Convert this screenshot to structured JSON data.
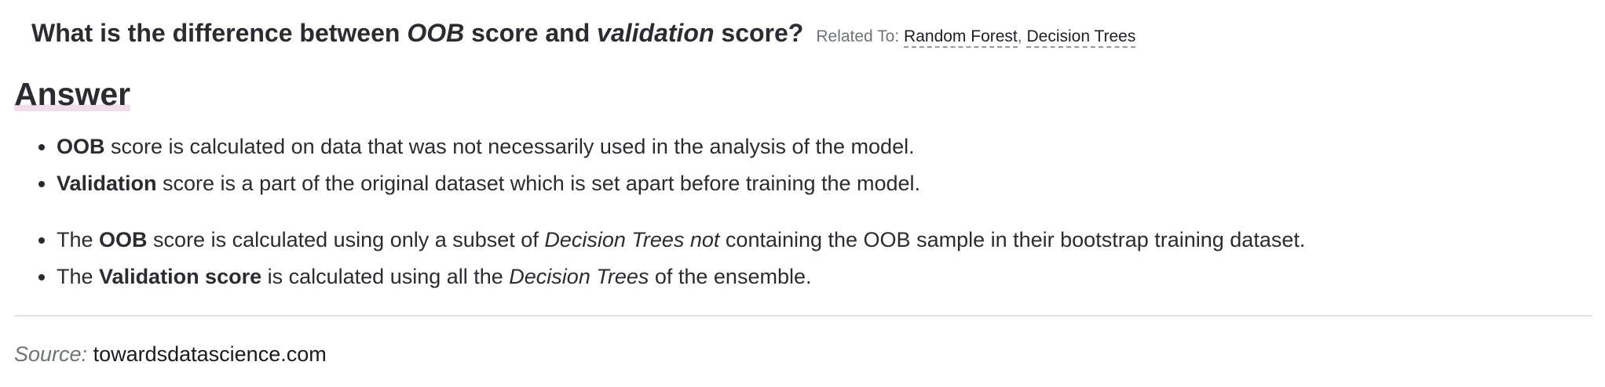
{
  "question": {
    "parts": [
      "What is the difference between ",
      "OOB",
      " score and ",
      "validation",
      " score?"
    ],
    "related_label": "Related To:",
    "related_links": [
      "Random Forest",
      "Decision Trees"
    ],
    "related_separator": ","
  },
  "answer": {
    "heading": "Answer",
    "group1": [
      {
        "bold": "OOB",
        "text": " score is calculated on data that was not necessarily used in the analysis of the model."
      },
      {
        "bold": "Validation",
        "text": " score is a part of the original dataset which is set apart before training the model."
      }
    ],
    "group2": [
      {
        "pre": "The ",
        "bold": "OOB",
        "mid": " score is calculated using only a subset of ",
        "italic": "Decision Trees not",
        "post": " containing the OOB sample in their bootstrap training dataset."
      },
      {
        "pre": "The ",
        "bold": "Validation score",
        "mid": " is calculated using all the ",
        "italic": "Decision Trees",
        "post": " of the ensemble."
      }
    ]
  },
  "source": {
    "label": "Source:",
    "value": "towardsdatascience.com"
  },
  "colors": {
    "text": "#2b2b31",
    "muted": "#6f7378",
    "heading_highlight": "#f3dceb",
    "divider": "#e4e4e4"
  }
}
